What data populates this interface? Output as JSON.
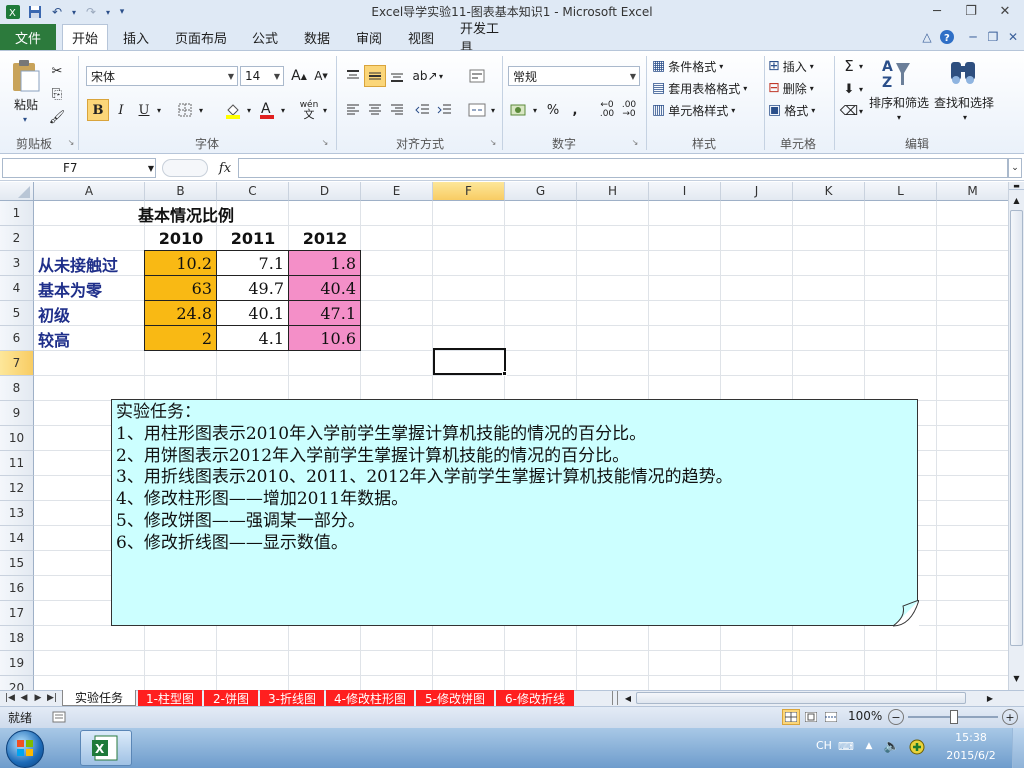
{
  "window": {
    "title": "Excel导学实验11-图表基本知识1 - Microsoft Excel"
  },
  "menu_tabs": {
    "file": "文件",
    "home": "开始",
    "insert": "插入",
    "page_layout": "页面布局",
    "formulas": "公式",
    "data": "数据",
    "review": "审阅",
    "view": "视图",
    "developer": "开发工具"
  },
  "ribbon": {
    "clipboard": {
      "paste": "粘贴",
      "label": "剪贴板"
    },
    "font": {
      "name": "宋体",
      "size": "14",
      "label": "字体",
      "bold": "B",
      "italic": "I",
      "underline": "U",
      "phonetic": "wén"
    },
    "alignment": {
      "label": "对齐方式"
    },
    "number": {
      "format": "常规",
      "label": "数字",
      "percent": "%",
      "comma": ",",
      "inc_decimal": ".00",
      "dec_decimal": ".00"
    },
    "styles": {
      "conditional": "条件格式",
      "table": "套用表格格式",
      "cell_styles": "单元格样式",
      "label": "样式"
    },
    "cells": {
      "insert": "插入",
      "delete": "删除",
      "format": "格式",
      "label": "单元格"
    },
    "editing": {
      "sort_filter": "排序和筛选",
      "find_select": "查找和选择",
      "label": "编辑"
    }
  },
  "formula_bar": {
    "name_box": "F7",
    "fx": "fx",
    "formula": ""
  },
  "columns": [
    "A",
    "B",
    "C",
    "D",
    "E",
    "F",
    "G",
    "H",
    "I",
    "J",
    "K",
    "L",
    "M"
  ],
  "selected_column": "F",
  "rows": [
    "1",
    "2",
    "3",
    "4",
    "5",
    "6",
    "7",
    "8",
    "9",
    "10",
    "11",
    "12",
    "13",
    "14",
    "15",
    "16",
    "17",
    "18",
    "19",
    "20"
  ],
  "selected_row": "7",
  "table": {
    "title": "基本情况比例",
    "years": [
      "2010",
      "2011",
      "2012"
    ],
    "rows": [
      {
        "label": "从未接触过",
        "values": [
          "10.2",
          "7.1",
          "1.8"
        ]
      },
      {
        "label": "基本为零",
        "values": [
          "63",
          "49.7",
          "40.4"
        ]
      },
      {
        "label": "初级",
        "values": [
          "24.8",
          "40.1",
          "47.1"
        ]
      },
      {
        "label": "较高",
        "values": [
          "2",
          "4.1",
          "10.6"
        ]
      }
    ],
    "colors": {
      "col_2010": "#f9b914",
      "col_2011": "#ffffff",
      "col_2012": "#f48fc8",
      "label": "#1f2f8a"
    }
  },
  "note": {
    "heading": "实验任务：",
    "lines": [
      "1、用柱形图表示2010年入学前学生掌握计算机技能的情况的百分比。",
      "2、用饼图表示2012年入学前学生掌握计算机技能的情况的百分比。",
      "3、用折线图表示2010、2011、2012年入学前学生掌握计算机技能情况的趋势。",
      "4、修改柱形图——增加2011年数据。",
      "5、修改饼图——强调某一部分。",
      "6、修改折线图——显示数值。"
    ],
    "background": "#ccffff"
  },
  "sheet_tabs": [
    "实验任务",
    "1-柱型图",
    "2-饼图",
    "3-折线图",
    "4-修改柱形图",
    "5-修改饼图",
    "6-修改折线"
  ],
  "status": {
    "ready": "就绪",
    "zoom": "100%"
  },
  "taskbar": {
    "ime": "CH",
    "time": "15:38",
    "date": "2015/6/2"
  }
}
